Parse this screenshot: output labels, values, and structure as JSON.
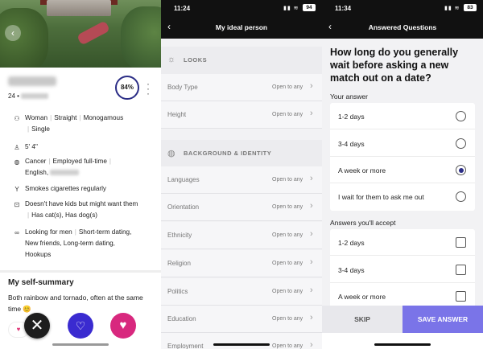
{
  "profile": {
    "match_percent": "84%",
    "age": "24 •",
    "details": {
      "identity": [
        "Woman",
        "Straight",
        "Monogamous"
      ],
      "identity_extra": "Single",
      "height": "5' 4\"",
      "sign_job": [
        "Cancer",
        "Employed full-time"
      ],
      "languages_prefix": "English,",
      "smoking": "Smokes cigarettes regularly",
      "kids": "Doesn't have kids but might want them",
      "pets": "Has cat(s), Has dog(s)",
      "looking_for": "Looking for men",
      "relationship": "Short-term dating,",
      "relationship_2": "New friends, Long-term dating,",
      "relationship_3": "Hookups"
    },
    "summary_title": "My self-summary",
    "summary_text": "Both rainbow and tornado, often at the same time 😊",
    "icons": {
      "back": "chevron-left-icon",
      "more": "kebab-icon",
      "identity": "people-icon",
      "height": "ruler-icon",
      "globe": "globe-icon",
      "drink": "cocktail-icon",
      "baby": "stroller-icon",
      "eye": "binoculars-icon"
    },
    "actions": {
      "pass": "✕",
      "superlike": "♡",
      "like": "♥"
    }
  },
  "ideal": {
    "time": "11:24",
    "battery": "94",
    "title": "My ideal person",
    "looks_label": "LOOKS",
    "background_label": "BACKGROUND & IDENTITY",
    "looks_rows": [
      {
        "label": "Body Type",
        "value": "Open to any"
      },
      {
        "label": "Height",
        "value": "Open to any"
      }
    ],
    "background_rows": [
      {
        "label": "Languages",
        "value": "Open to any"
      },
      {
        "label": "Orientation",
        "value": "Open to any"
      },
      {
        "label": "Ethnicity",
        "value": "Open to any"
      },
      {
        "label": "Religion",
        "value": "Open to any"
      },
      {
        "label": "Politics",
        "value": "Open to any"
      },
      {
        "label": "Education",
        "value": "Open to any"
      },
      {
        "label": "Employment",
        "value": "Open to any"
      }
    ]
  },
  "answered": {
    "time": "11:34",
    "battery": "83",
    "title": "Answered Questions",
    "question": "How long do you generally wait before asking a new match out on a date?",
    "your_answer_label": "Your answer",
    "your_answers": [
      {
        "label": "1-2 days",
        "selected": false
      },
      {
        "label": "3-4 days",
        "selected": false
      },
      {
        "label": "A week or more",
        "selected": true
      },
      {
        "label": "I wait for them to ask me out",
        "selected": false
      }
    ],
    "accept_label": "Answers you'll accept",
    "accept_answers": [
      {
        "label": "1-2 days",
        "checked": false
      },
      {
        "label": "3-4 days",
        "checked": false
      },
      {
        "label": "A week or more",
        "checked": false
      }
    ],
    "skip": "SKIP",
    "save": "SAVE ANSWER"
  }
}
